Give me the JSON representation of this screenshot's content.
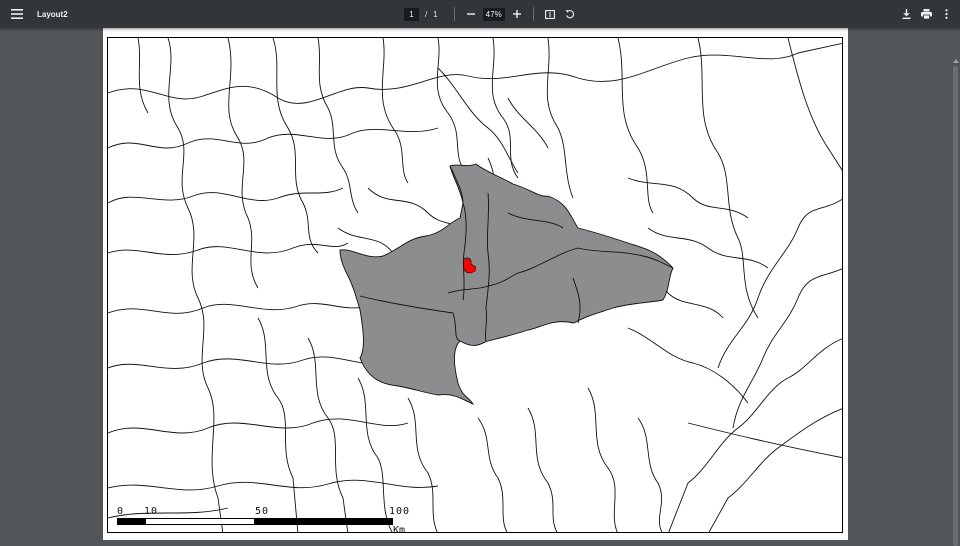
{
  "toolbar": {
    "title": "Layout2",
    "page_current": "1",
    "page_separator": "/",
    "page_total": "1",
    "zoom": "47%",
    "icons": {
      "menu": "menu-icon",
      "zoom_out": "minus-icon",
      "zoom_in": "plus-icon",
      "fit": "fit-page-icon",
      "rotate": "rotate-icon",
      "download": "download-icon",
      "print": "print-icon",
      "more": "more-vert-icon"
    }
  },
  "map": {
    "highlight_color": "#ff0000",
    "selection_color": "#8c8d8f",
    "scale_bar": {
      "labels": [
        "0",
        "10",
        "50",
        "100"
      ],
      "unit": "Km"
    }
  },
  "colors": {
    "toolbar_bg": "#323639",
    "viewer_bg": "#525659",
    "page_bg": "#ffffff"
  }
}
